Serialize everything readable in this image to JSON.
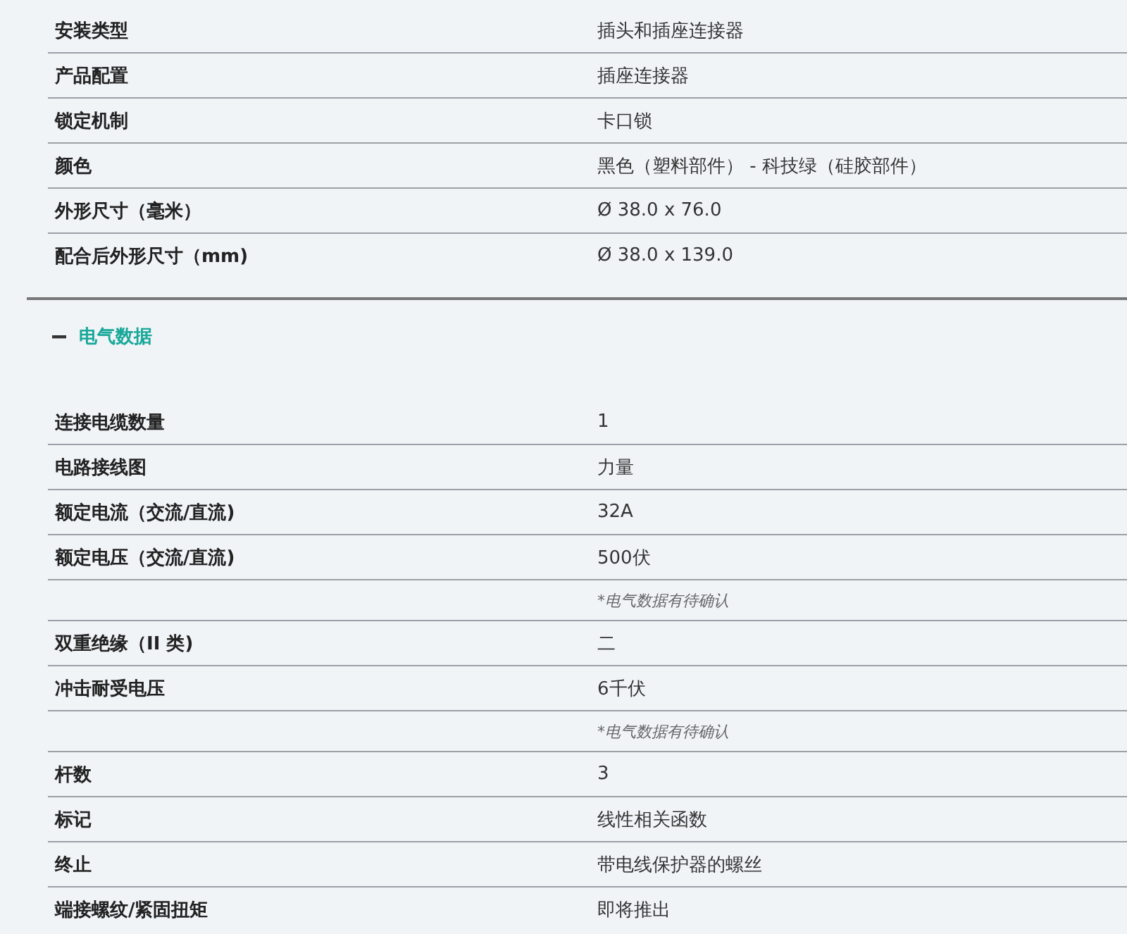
{
  "mechanical_rows": [
    {
      "kind": "spec",
      "label": "安装类型",
      "value": "插头和插座连接器"
    },
    {
      "kind": "spec",
      "label": "产品配置",
      "value": "插座连接器"
    },
    {
      "kind": "spec",
      "label": "锁定机制",
      "value": "卡口锁"
    },
    {
      "kind": "spec",
      "label": "颜色",
      "value": "黑色（塑料部件） - 科技绿（硅胶部件）"
    },
    {
      "kind": "spec",
      "label": "外形尺寸（毫米）",
      "value": "Ø 38.0 x 76.0"
    },
    {
      "kind": "spec",
      "label": "配合后外形尺寸（mm)",
      "value": "Ø 38.0 x 139.0"
    }
  ],
  "electrical_section": {
    "title": "电气数据",
    "expanded": true,
    "rows": [
      {
        "kind": "spec",
        "label": "连接电缆数量",
        "value": "1"
      },
      {
        "kind": "spec",
        "label": "电路接线图",
        "value": "力量"
      },
      {
        "kind": "spec",
        "label": "额定电流（交流/直流)",
        "value": "32A"
      },
      {
        "kind": "spec",
        "label": "额定电压（交流/直流)",
        "value": "500伏"
      },
      {
        "kind": "note",
        "value": "*电气数据有待确认"
      },
      {
        "kind": "spec",
        "label": "双重绝缘（II 类)",
        "value": "二"
      },
      {
        "kind": "spec",
        "label": "冲击耐受电压",
        "value": "6千伏"
      },
      {
        "kind": "note",
        "value": "*电气数据有待确认"
      },
      {
        "kind": "spec",
        "label": "杆数",
        "value": "3"
      },
      {
        "kind": "spec",
        "label": "标记",
        "value": "线性相关函数"
      },
      {
        "kind": "spec",
        "label": "终止",
        "value": "带电线保护器的螺丝"
      },
      {
        "kind": "spec",
        "label": "端接螺纹/紧固扭矩",
        "value": "即将推出"
      }
    ]
  }
}
